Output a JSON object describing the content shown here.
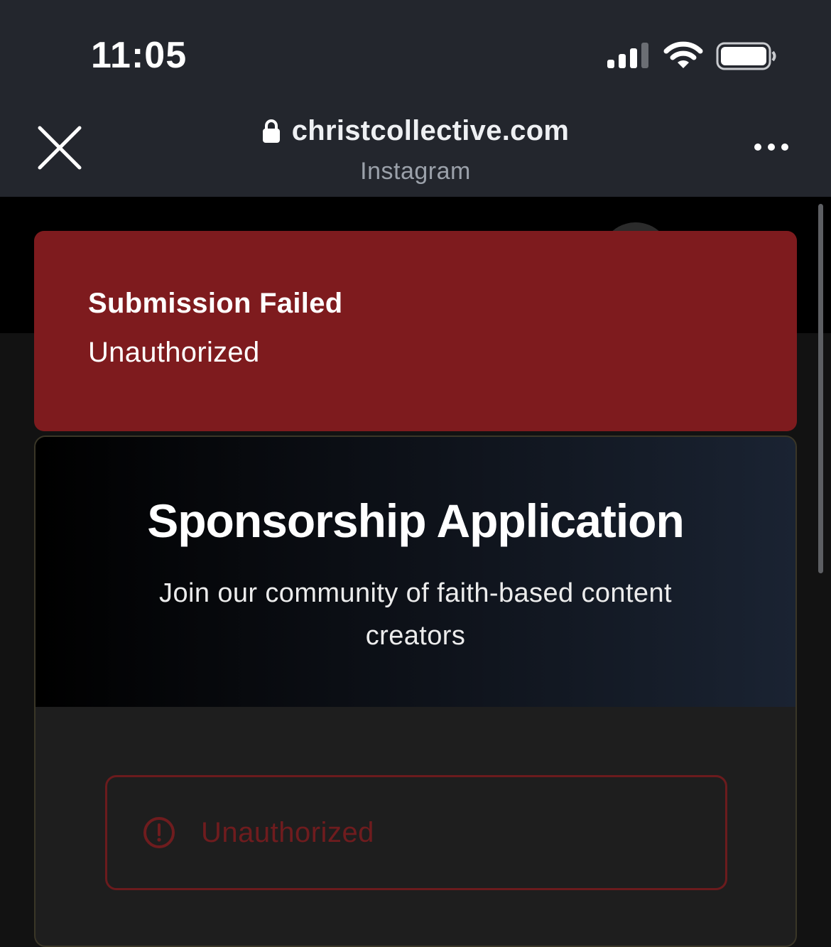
{
  "status_bar": {
    "time": "11:05",
    "icons": [
      "cellular-signal-icon",
      "wifi-icon",
      "battery-icon"
    ]
  },
  "browser": {
    "close_icon": "close-icon",
    "lock_icon": "lock-icon",
    "url": "christcollective.com",
    "source": "Instagram",
    "more_icon": "more-icon"
  },
  "toast": {
    "title": "Submission Failed",
    "message": "Unauthorized",
    "background": "#7e1b1e"
  },
  "card": {
    "title": "Sponsorship Application",
    "subtitle": "Join our community of faith-based content creators",
    "error": {
      "icon": "alert-circle-icon",
      "message": "Unauthorized",
      "color": "#6f1c1e"
    }
  }
}
